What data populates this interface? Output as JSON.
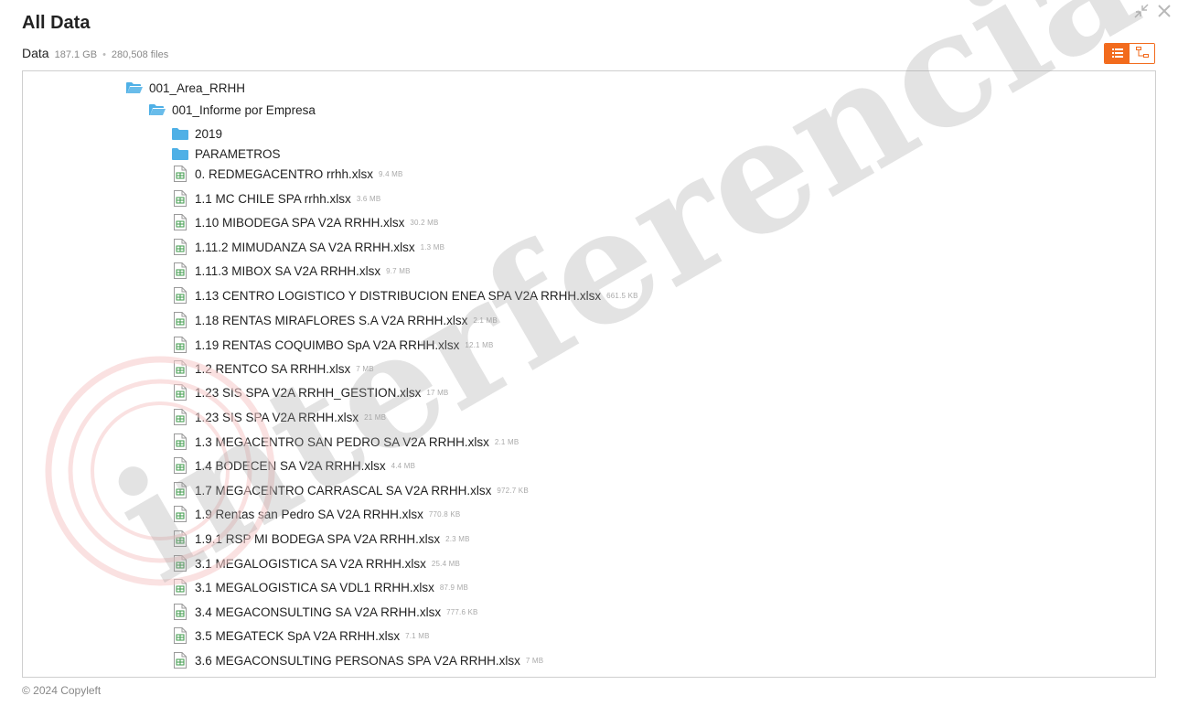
{
  "window": {
    "title": "All Data"
  },
  "dataset": {
    "name": "Data",
    "size": "187.1 GB",
    "separator": "•",
    "files": "280,508 files"
  },
  "footer": {
    "text": "© 2024 Copyleft"
  },
  "watermark": {
    "text": "interferencia"
  },
  "colors": {
    "accent": "#f26b1d",
    "folder": "#4fb0e6",
    "excel": "#3c9a4a"
  },
  "tree": [
    {
      "name": "001_Area_RRHH",
      "type": "folder-open",
      "size": ""
    },
    {
      "name": "001_Informe por Empresa",
      "type": "folder-open",
      "size": ""
    },
    {
      "name": "2019",
      "type": "folder",
      "size": ""
    },
    {
      "name": "PARAMETROS",
      "type": "folder",
      "size": ""
    },
    {
      "name": "0. REDMEGACENTRO rrhh.xlsx",
      "type": "xlsx",
      "size": "9.4 MB"
    },
    {
      "name": "1.1 MC CHILE SPA rrhh.xlsx",
      "type": "xlsx",
      "size": "3.6 MB"
    },
    {
      "name": "1.10 MIBODEGA SPA V2A RRHH.xlsx",
      "type": "xlsx",
      "size": "30.2 MB"
    },
    {
      "name": "1.11.2 MIMUDANZA SA V2A RRHH.xlsx",
      "type": "xlsx",
      "size": "1.3 MB"
    },
    {
      "name": "1.11.3 MIBOX SA V2A RRHH.xlsx",
      "type": "xlsx",
      "size": "9.7 MB"
    },
    {
      "name": "1.13 CENTRO LOGISTICO Y DISTRIBUCION ENEA SPA V2A RRHH.xlsx",
      "type": "xlsx",
      "size": "661.5 KB"
    },
    {
      "name": "1.18 RENTAS MIRAFLORES S.A V2A RRHH.xlsx",
      "type": "xlsx",
      "size": "2.1 MB"
    },
    {
      "name": "1.19 RENTAS COQUIMBO SpA V2A RRHH.xlsx",
      "type": "xlsx",
      "size": "12.1 MB"
    },
    {
      "name": "1.2 RENTCO SA RRHH.xlsx",
      "type": "xlsx",
      "size": "7 MB"
    },
    {
      "name": "1.23 SIS SPA V2A RRHH_GESTION.xlsx",
      "type": "xlsx",
      "size": "17 MB"
    },
    {
      "name": "1.23 SIS SPA V2A RRHH.xlsx",
      "type": "xlsx",
      "size": "21 MB"
    },
    {
      "name": "1.3 MEGACENTRO SAN PEDRO SA V2A RRHH.xlsx",
      "type": "xlsx",
      "size": "2.1 MB"
    },
    {
      "name": "1.4 BODECEN SA V2A RRHH.xlsx",
      "type": "xlsx",
      "size": "4.4 MB"
    },
    {
      "name": "1.7 MEGACENTRO CARRASCAL SA V2A RRHH.xlsx",
      "type": "xlsx",
      "size": "972.7 KB"
    },
    {
      "name": "1.9 Rentas san Pedro SA V2A RRHH.xlsx",
      "type": "xlsx",
      "size": "770.8 KB"
    },
    {
      "name": "1.9.1 RSP MI BODEGA SPA V2A RRHH.xlsx",
      "type": "xlsx",
      "size": "2.3 MB"
    },
    {
      "name": "3.1 MEGALOGISTICA SA V2A RRHH.xlsx",
      "type": "xlsx",
      "size": "25.4 MB"
    },
    {
      "name": "3.1 MEGALOGISTICA SA VDL1 RRHH.xlsx",
      "type": "xlsx",
      "size": "87.9 MB"
    },
    {
      "name": "3.4 MEGACONSULTING SA V2A RRHH.xlsx",
      "type": "xlsx",
      "size": "777.6 KB"
    },
    {
      "name": "3.5 MEGATECK SpA V2A RRHH.xlsx",
      "type": "xlsx",
      "size": "7.1 MB"
    },
    {
      "name": "3.6 MEGACONSULTING PERSONAS SPA V2A RRHH.xlsx",
      "type": "xlsx",
      "size": "7 MB"
    }
  ]
}
